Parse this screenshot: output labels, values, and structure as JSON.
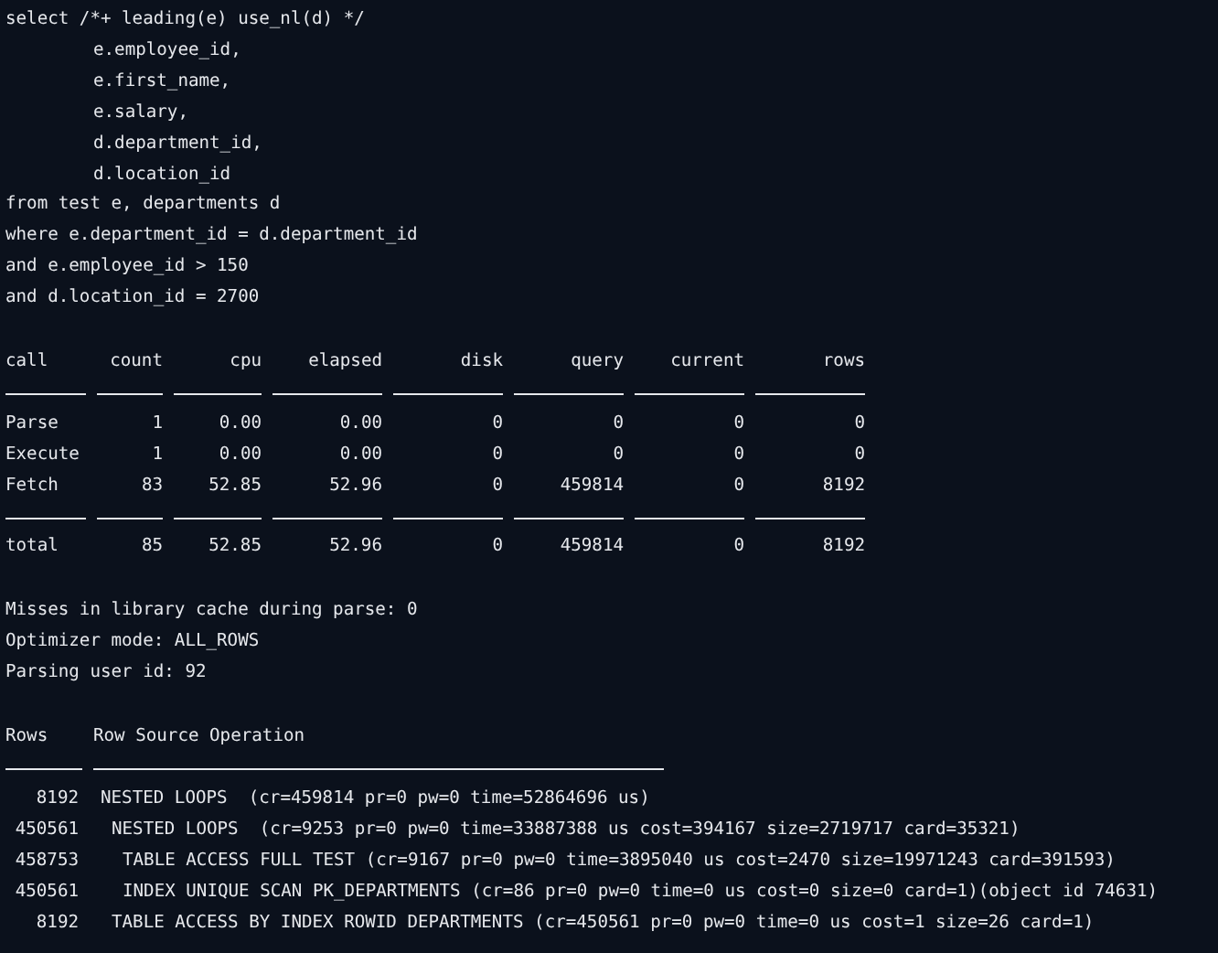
{
  "sql_lines": [
    {
      "kind": "clause",
      "text": "select /*+ leading(e) use_nl(d) */"
    },
    {
      "kind": "column",
      "text": "e.employee_id,"
    },
    {
      "kind": "column",
      "text": "e.first_name,"
    },
    {
      "kind": "column",
      "text": "e.salary,"
    },
    {
      "kind": "column",
      "text": "d.department_id,"
    },
    {
      "kind": "column",
      "text": "d.location_id"
    },
    {
      "kind": "clause",
      "text": "from test e, departments d"
    },
    {
      "kind": "clause",
      "text": "where e.department_id = d.department_id"
    },
    {
      "kind": "clause",
      "text": "and e.employee_id > 150"
    },
    {
      "kind": "clause",
      "text": "and d.location_id = 2700"
    }
  ],
  "stats_table": {
    "columns": [
      "call",
      "count",
      "cpu",
      "elapsed",
      "disk",
      "query",
      "current",
      "rows"
    ],
    "rows": [
      {
        "kind": "detail",
        "cells": [
          "Parse",
          "1",
          "0.00",
          "0.00",
          "0",
          "0",
          "0",
          "0"
        ]
      },
      {
        "kind": "detail",
        "cells": [
          "Execute",
          "1",
          "0.00",
          "0.00",
          "0",
          "0",
          "0",
          "0"
        ]
      },
      {
        "kind": "detail",
        "cells": [
          "Fetch",
          "83",
          "52.85",
          "52.96",
          "0",
          "459814",
          "0",
          "8192"
        ]
      },
      {
        "kind": "total",
        "cells": [
          "total",
          "85",
          "52.85",
          "52.96",
          "0",
          "459814",
          "0",
          "8192"
        ]
      }
    ]
  },
  "notes": [
    "Misses in library cache during parse: 0",
    "Optimizer mode: ALL_ROWS",
    "Parsing user id: 92"
  ],
  "row_source": {
    "columns": [
      "Rows",
      "Row Source Operation"
    ],
    "operations": [
      {
        "rows": "8192",
        "operation": "NESTED LOOPS  (cr=459814 pr=0 pw=0 time=52864696 us)",
        "children": [
          {
            "rows": "450561",
            "operation": "NESTED LOOPS  (cr=9253 pr=0 pw=0 time=33887388 us cost=394167 size=2719717 card=35321)",
            "children": [
              {
                "rows": "458753",
                "operation": "TABLE ACCESS FULL TEST (cr=9167 pr=0 pw=0 time=3895040 us cost=2470 size=19971243 card=391593)"
              },
              {
                "rows": "450561",
                "operation": "INDEX UNIQUE SCAN PK_DEPARTMENTS (cr=86 pr=0 pw=0 time=0 us cost=0 size=0 card=1)(object id 74631)"
              }
            ]
          },
          {
            "rows": "8192",
            "operation": "TABLE ACCESS BY INDEX ROWID DEPARTMENTS (cr=450561 pr=0 pw=0 time=0 us cost=1 size=26 card=1)"
          }
        ]
      }
    ]
  }
}
